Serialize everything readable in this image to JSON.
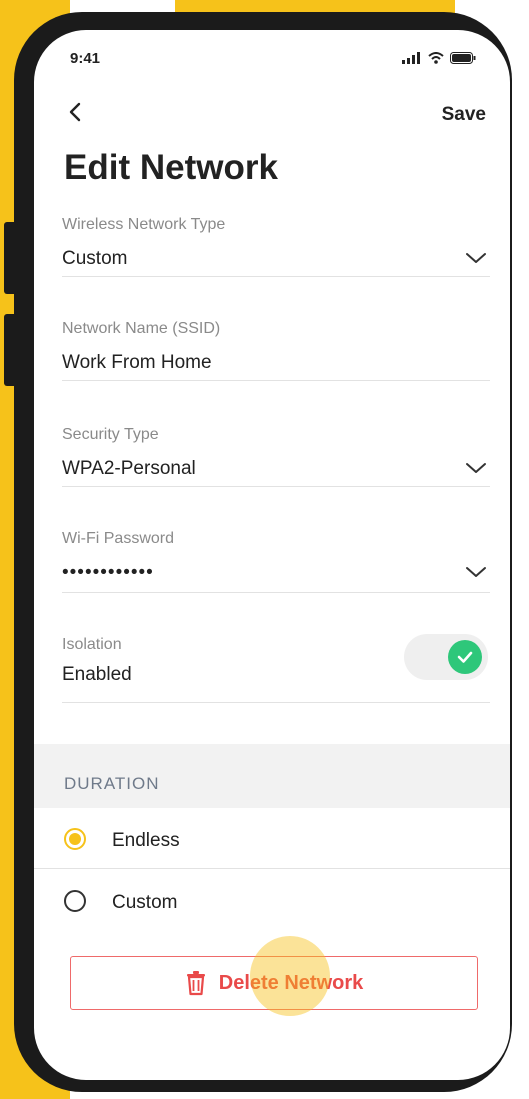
{
  "status_bar": {
    "time": "9:41"
  },
  "header": {
    "back_icon": "chevron-left-icon",
    "save_label": "Save",
    "title": "Edit Network"
  },
  "fields": {
    "network_type": {
      "label": "Wireless Network Type",
      "value": "Custom"
    },
    "ssid": {
      "label": "Network Name (SSID)",
      "value": "Work From Home"
    },
    "security": {
      "label": "Security Type",
      "value": "WPA2-Personal"
    },
    "password": {
      "label": "Wi-Fi Password",
      "value": "••••••••••••"
    },
    "isolation": {
      "label": "Isolation",
      "value": "Enabled",
      "on": true
    }
  },
  "duration": {
    "header": "DURATION",
    "options": [
      {
        "label": "Endless",
        "selected": true
      },
      {
        "label": "Custom",
        "selected": false
      }
    ]
  },
  "delete_label": "Delete Network",
  "colors": {
    "accent": "#f6c21a",
    "toggle_on": "#2ec77a",
    "danger": "#e94a4a"
  }
}
